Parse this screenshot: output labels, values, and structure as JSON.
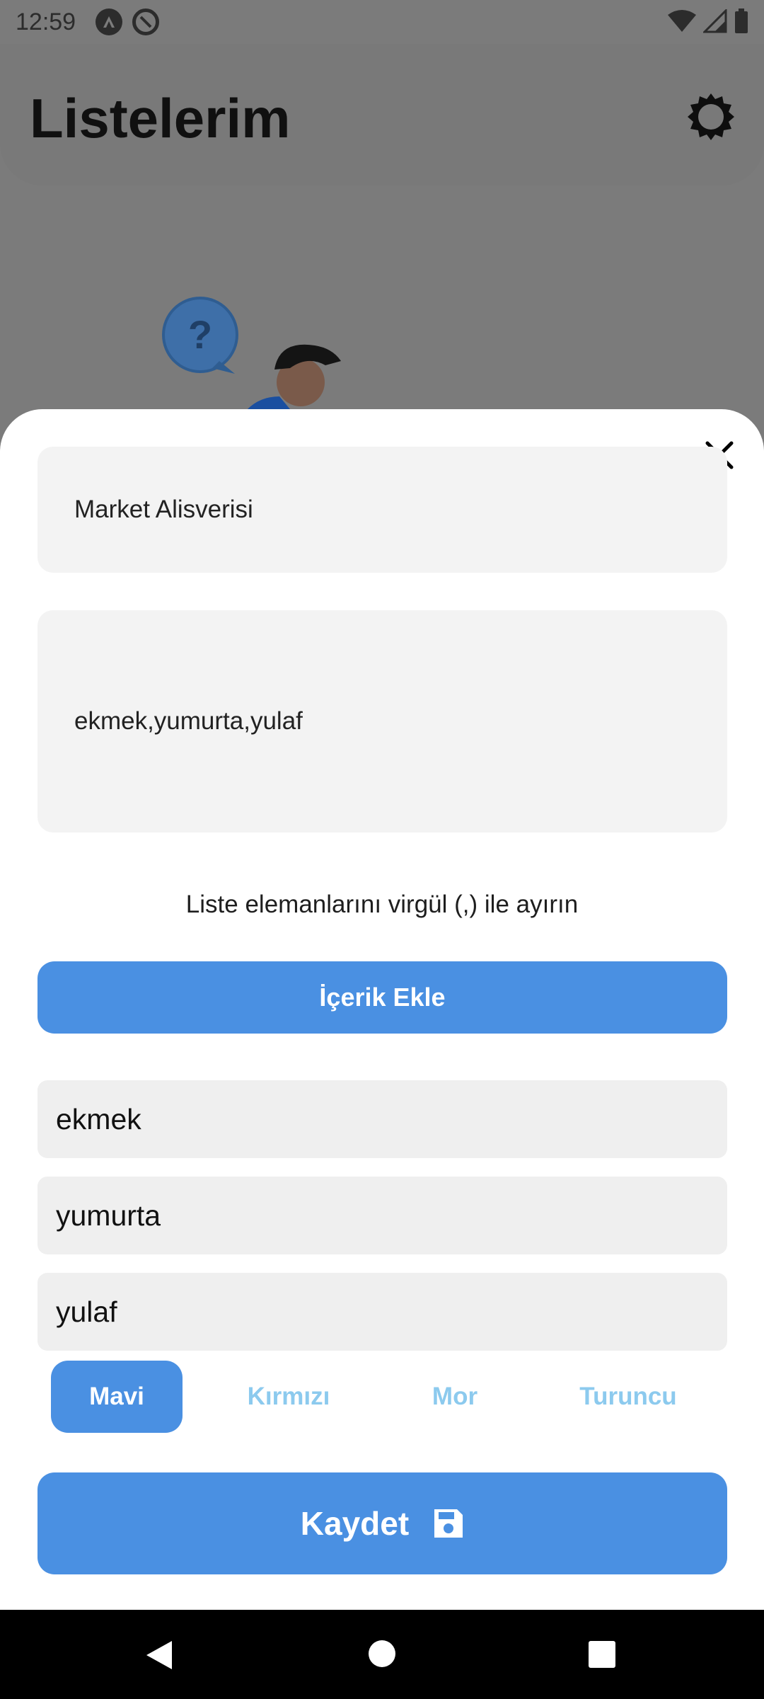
{
  "status_bar": {
    "time": "12:59"
  },
  "header": {
    "title": "Listelerim"
  },
  "sheet": {
    "title_value": "Market Alisverisi",
    "items_value": "ekmek,yumurta,yulaf",
    "hint": "Liste elemanlarını virgül (,) ile ayırın",
    "add_button": "İçerik Ekle",
    "items": [
      "ekmek",
      "yumurta",
      "yulaf"
    ],
    "colors": [
      {
        "label": "Mavi",
        "selected": true
      },
      {
        "label": "Kırmızı",
        "selected": false
      },
      {
        "label": "Mor",
        "selected": false
      },
      {
        "label": "Turuncu",
        "selected": false
      }
    ],
    "save_button": "Kaydet"
  },
  "theme": {
    "accent": "#4a90e2",
    "unselected_color_text": "#8ccaee"
  }
}
